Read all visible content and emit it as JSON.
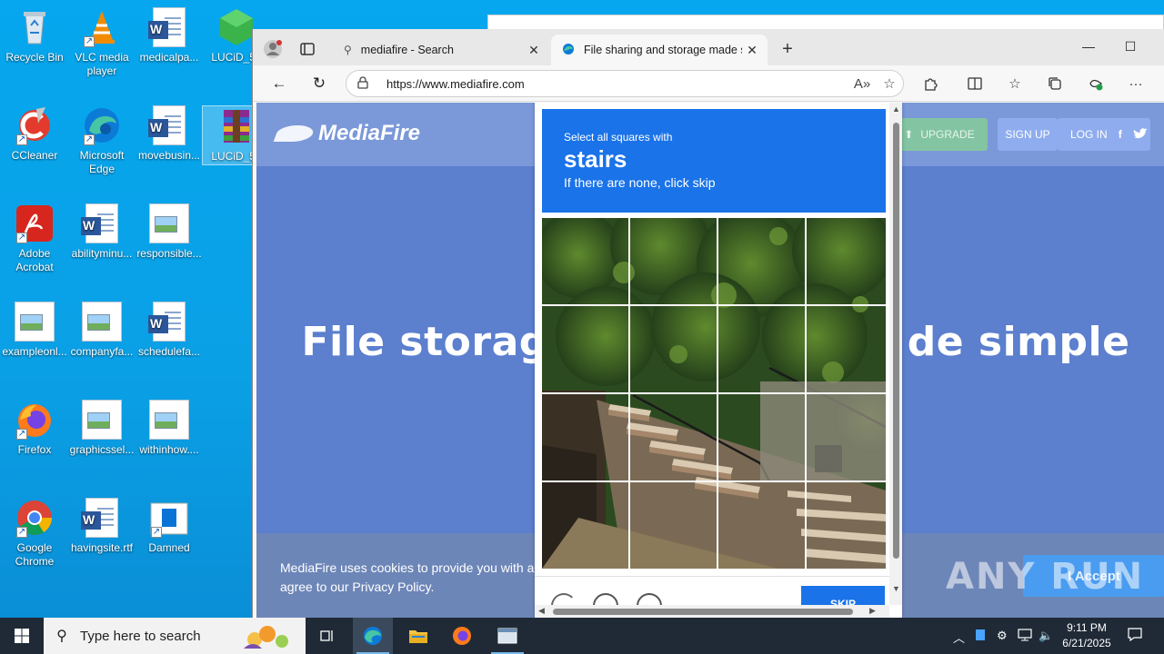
{
  "desktop": {
    "icons": [
      {
        "label": "Recycle Bin"
      },
      {
        "label": "VLC media player"
      },
      {
        "label": "medicalpa..."
      },
      {
        "label": "LUCiD_5e"
      },
      {
        "label": "CCleaner"
      },
      {
        "label": "Microsoft Edge"
      },
      {
        "label": "movebusin..."
      },
      {
        "label": "LUCiD_5e"
      },
      {
        "label": "Adobe Acrobat"
      },
      {
        "label": "abilityminu..."
      },
      {
        "label": "responsible..."
      },
      {
        "label": "exampleonl..."
      },
      {
        "label": "companyfa..."
      },
      {
        "label": "schedulefa..."
      },
      {
        "label": "Firefox"
      },
      {
        "label": "graphicssel..."
      },
      {
        "label": "withinhow...."
      },
      {
        "label": "Google Chrome"
      },
      {
        "label": "havingsite.rtf"
      },
      {
        "label": "Damned"
      }
    ]
  },
  "browser": {
    "tabs": [
      {
        "title": "mediafire - Search",
        "icon": "search-icon"
      },
      {
        "title": "File sharing and storage made sin",
        "icon": "edge-icon"
      }
    ],
    "url": "https://www.mediafire.com"
  },
  "page": {
    "logo": "MediaFire",
    "upgrade": "UPGRADE",
    "signup": "SIGN UP",
    "login": "LOG IN",
    "hero_title_left": "File storag",
    "hero_title_right": "de simple",
    "cookie_text": "MediaFire uses cookies to provide you with a p",
    "cookie_text_2": "agree to our Privacy Policy.",
    "cookie_u": "u",
    "accept": "I Accept"
  },
  "captcha": {
    "line1": "Select all squares with",
    "word": "stairs",
    "line3": "If there are none, click skip",
    "skip": "SKIP"
  },
  "watermark": "ANY RUN",
  "taskbar": {
    "search_placeholder": "Type here to search",
    "time": "9:11 PM",
    "date": "6/21/2025"
  },
  "colors": {
    "captcha_blue": "#1a73e8",
    "desktop_blue": "#06a7ee",
    "taskbar": "#1f2a36"
  }
}
